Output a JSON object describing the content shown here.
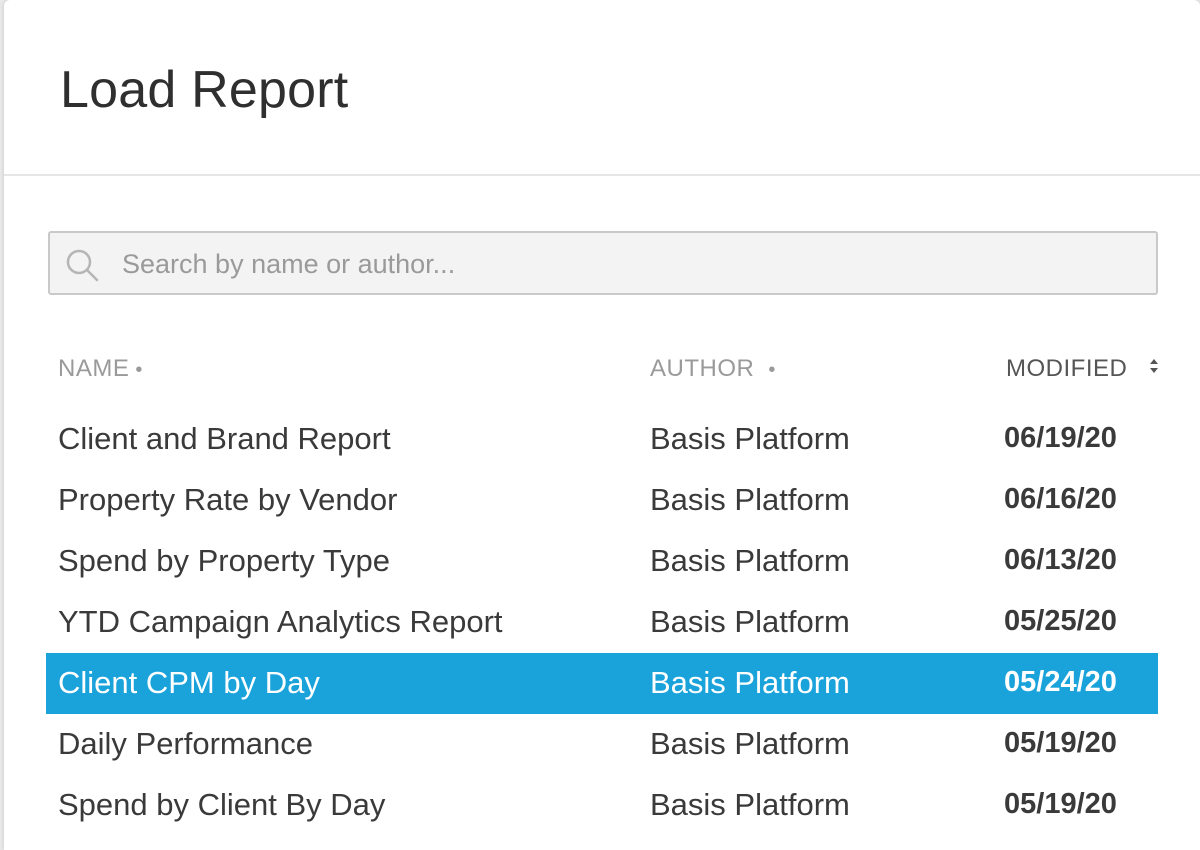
{
  "dialog": {
    "title": "Load Report"
  },
  "search": {
    "placeholder": "Search by name or author...",
    "icon": "search-icon"
  },
  "columns": {
    "name": "NAME",
    "author": "AUTHOR",
    "modified": "MODIFIED",
    "sort_dot": "•"
  },
  "rows": [
    {
      "name": "Client and Brand Report",
      "author": "Basis Platform",
      "modified": "06/19/20",
      "selected": false
    },
    {
      "name": "Property Rate by Vendor",
      "author": "Basis Platform",
      "modified": "06/16/20",
      "selected": false
    },
    {
      "name": "Spend by Property Type",
      "author": "Basis Platform",
      "modified": "06/13/20",
      "selected": false
    },
    {
      "name": "YTD Campaign Analytics Report",
      "author": "Basis Platform",
      "modified": "05/25/20",
      "selected": false
    },
    {
      "name": "Client CPM by Day",
      "author": "Basis Platform",
      "modified": "05/24/20",
      "selected": true
    },
    {
      "name": "Daily Performance",
      "author": "Basis Platform",
      "modified": "05/19/20",
      "selected": false
    },
    {
      "name": "Spend by Client By Day",
      "author": "Basis Platform",
      "modified": "05/19/20",
      "selected": false
    }
  ],
  "colors": {
    "selected_row": "#1aa3db",
    "text": "#3a3a3a",
    "header_muted": "#9a9a9a"
  }
}
